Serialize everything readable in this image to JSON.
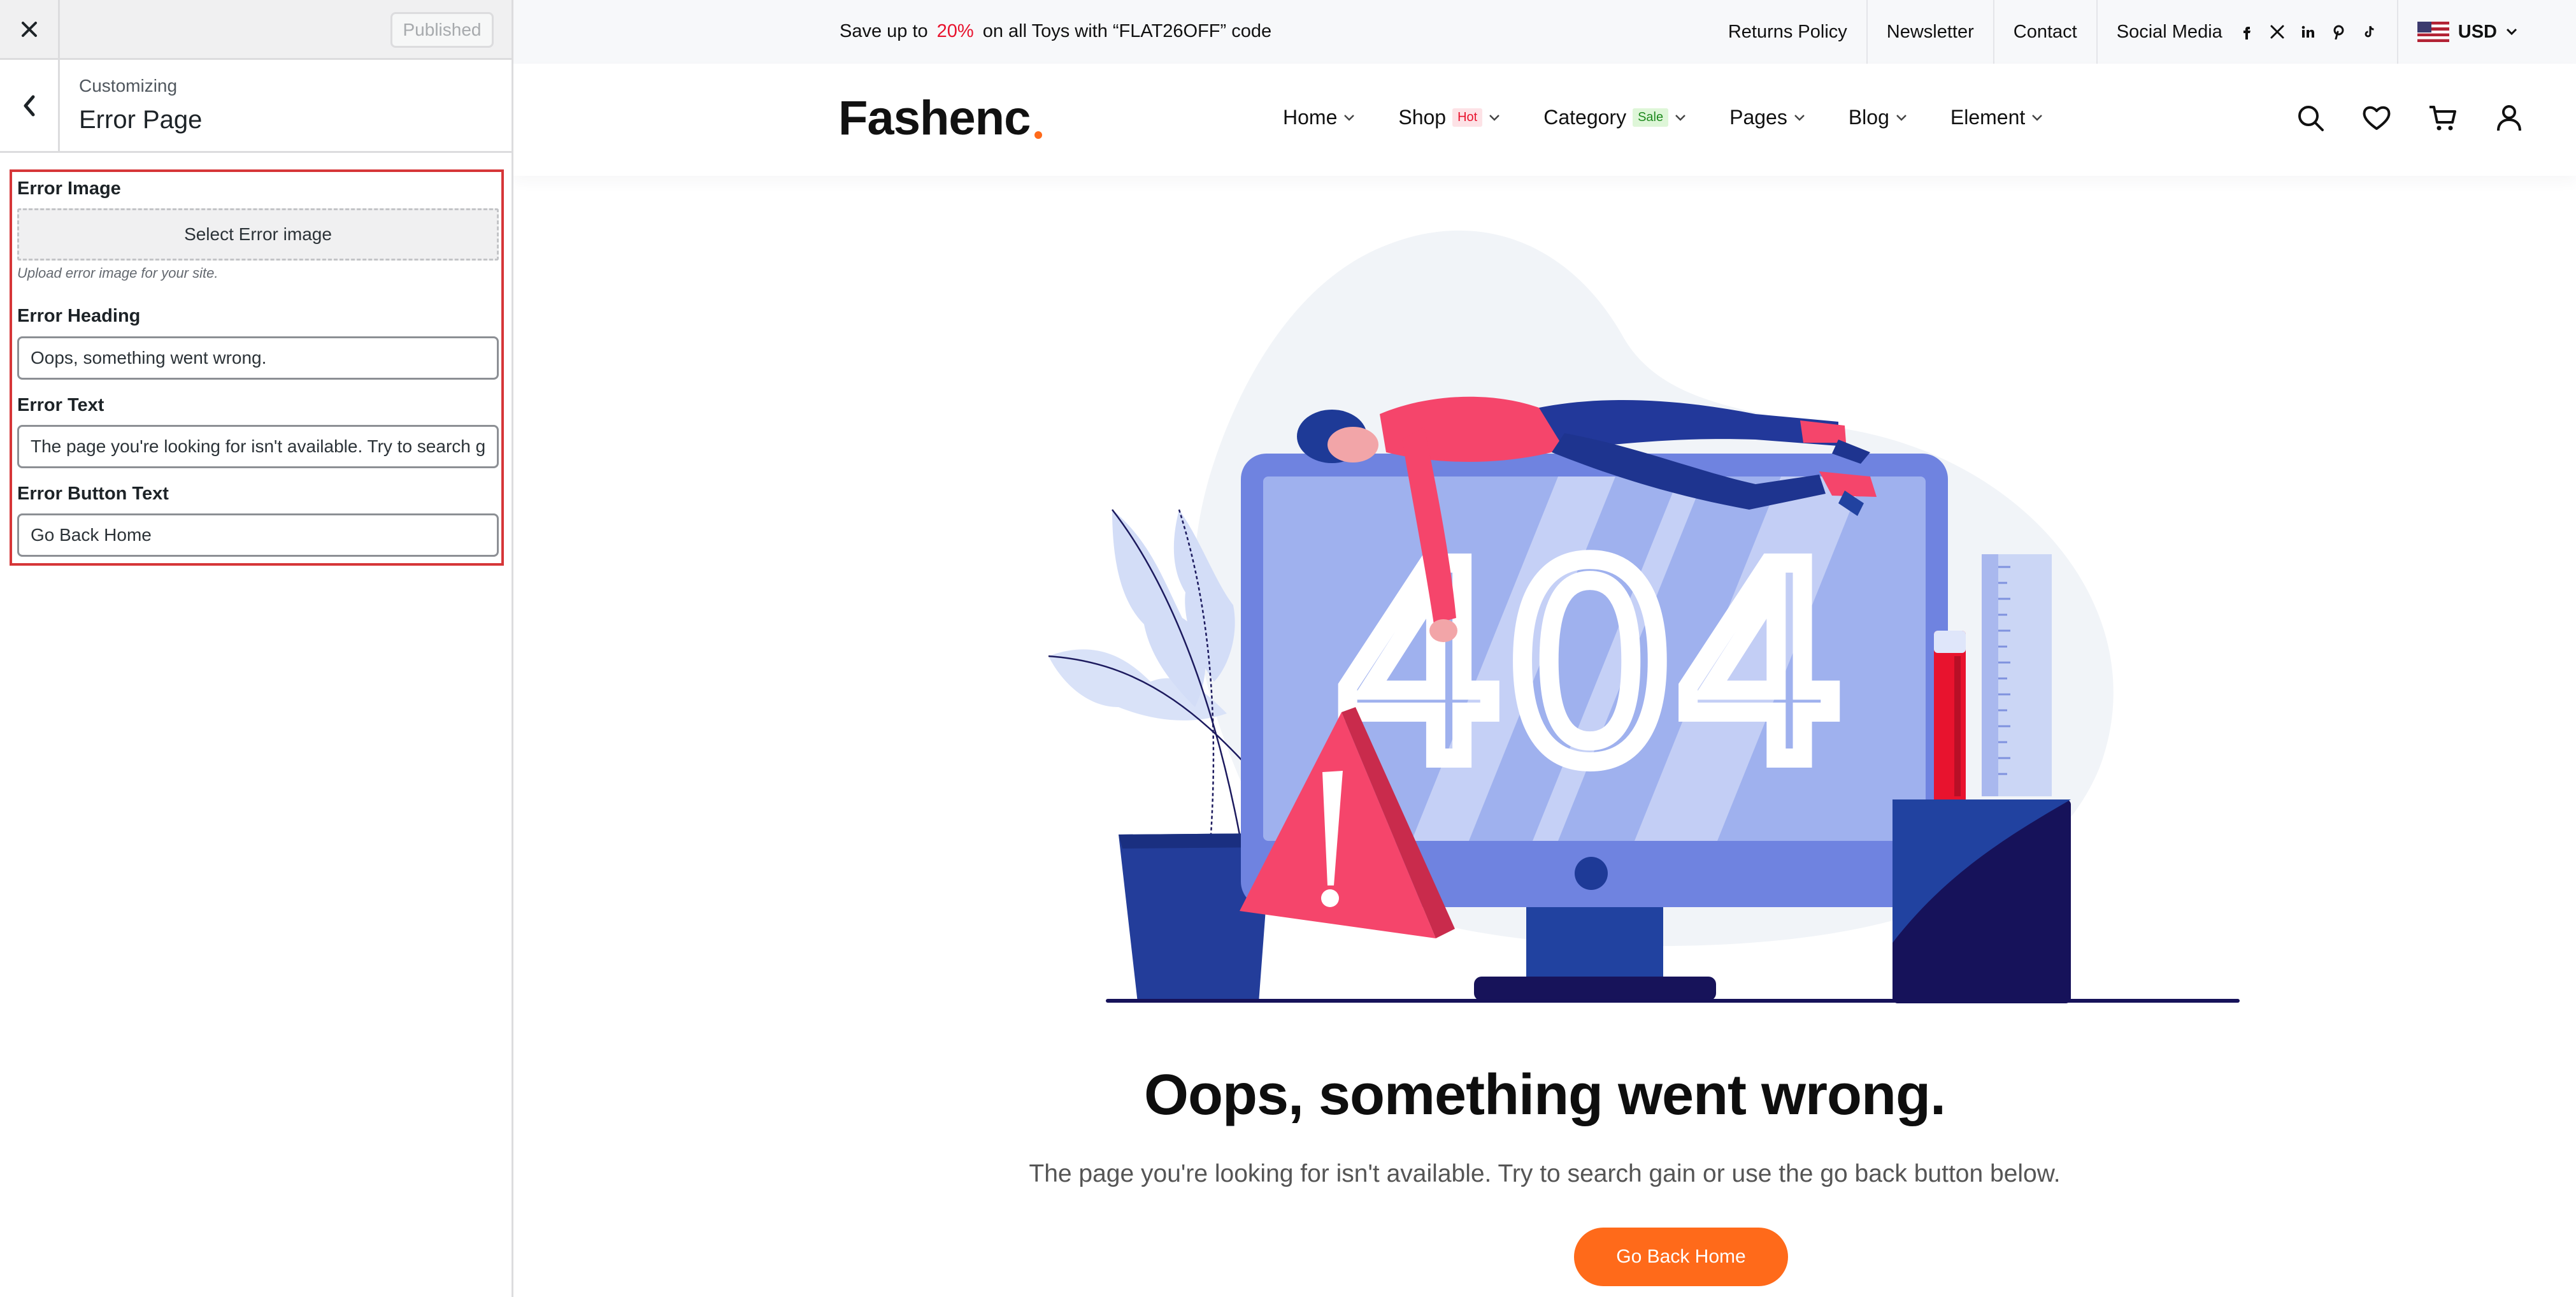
{
  "customizer": {
    "published_label": "Published",
    "section_parent": "Customizing",
    "section_title": "Error Page",
    "fields": {
      "error_image": {
        "label": "Error Image",
        "button": "Select Error image",
        "description": "Upload error image for your site."
      },
      "error_heading": {
        "label": "Error Heading",
        "value": "Oops, something went wrong."
      },
      "error_text": {
        "label": "Error Text",
        "value": "The page you're looking for isn't available. Try to search gain or use the go back button below."
      },
      "error_button_text": {
        "label": "Error Button Text",
        "value": "Go Back Home"
      }
    }
  },
  "topbar": {
    "promo_before": "Save up to",
    "promo_percent": "20%",
    "promo_after": "on all Toys with “FLAT26OFF” code",
    "links": [
      "Returns Policy",
      "Newsletter",
      "Contact"
    ],
    "social_label": "Social Media",
    "social_icons": [
      "facebook-icon",
      "x-icon",
      "linkedin-icon",
      "pinterest-icon",
      "tiktok-icon"
    ],
    "currency": "USD"
  },
  "header": {
    "logo": "Fashenc",
    "nav": [
      {
        "label": "Home"
      },
      {
        "label": "Shop",
        "badge": "Hot"
      },
      {
        "label": "Category",
        "badge": "Sale"
      },
      {
        "label": "Pages"
      },
      {
        "label": "Blog"
      },
      {
        "label": "Element"
      }
    ],
    "icons": [
      "search-icon",
      "heart-icon",
      "cart-icon",
      "user-icon"
    ]
  },
  "error_page": {
    "illustration_text": "404",
    "heading": "Oops, something went wrong.",
    "text": "The page you're looking for isn't available. Try to search gain or use the go back button below.",
    "button": "Go Back Home"
  },
  "colors": {
    "accent": "#ff6a1a",
    "promo_red": "#e8132e",
    "highlight_border": "#d63638"
  }
}
